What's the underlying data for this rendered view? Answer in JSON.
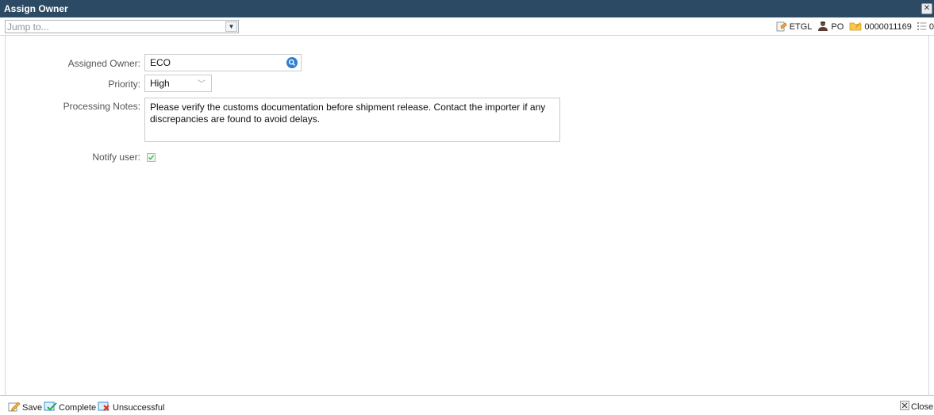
{
  "window": {
    "title": "Assign Owner"
  },
  "toolbar": {
    "jump_placeholder": "Jump to...",
    "context": {
      "etgl_label": "ETGL",
      "po_label": "PO",
      "id_label": "0000011169",
      "count_label": "0"
    }
  },
  "form": {
    "assigned_owner": {
      "label": "Assigned Owner:",
      "value": "ECO"
    },
    "priority": {
      "label": "Priority:",
      "value": "High"
    },
    "notes": {
      "label": "Processing Notes:",
      "value": "Please verify the customs documentation before shipment release. Contact the importer if any discrepancies are found to avoid delays."
    },
    "notify": {
      "label": "Notify user:",
      "checked": true
    }
  },
  "actions": {
    "save_label": "Save",
    "complete_label": "Complete",
    "unsuccessful_label": "Unsuccessful",
    "close_label": "Close"
  },
  "icons": [
    "close-icon",
    "chevron-down-icon",
    "tag-icon",
    "user-icon",
    "folder-icon",
    "list-icon",
    "search-icon",
    "check-icon",
    "edit-icon",
    "complete-icon",
    "unsuccessful-icon"
  ],
  "colors": {
    "titlebar": "#2c4a63",
    "search_button": "#2f7fd0",
    "checkbox_check": "#4caf50"
  }
}
